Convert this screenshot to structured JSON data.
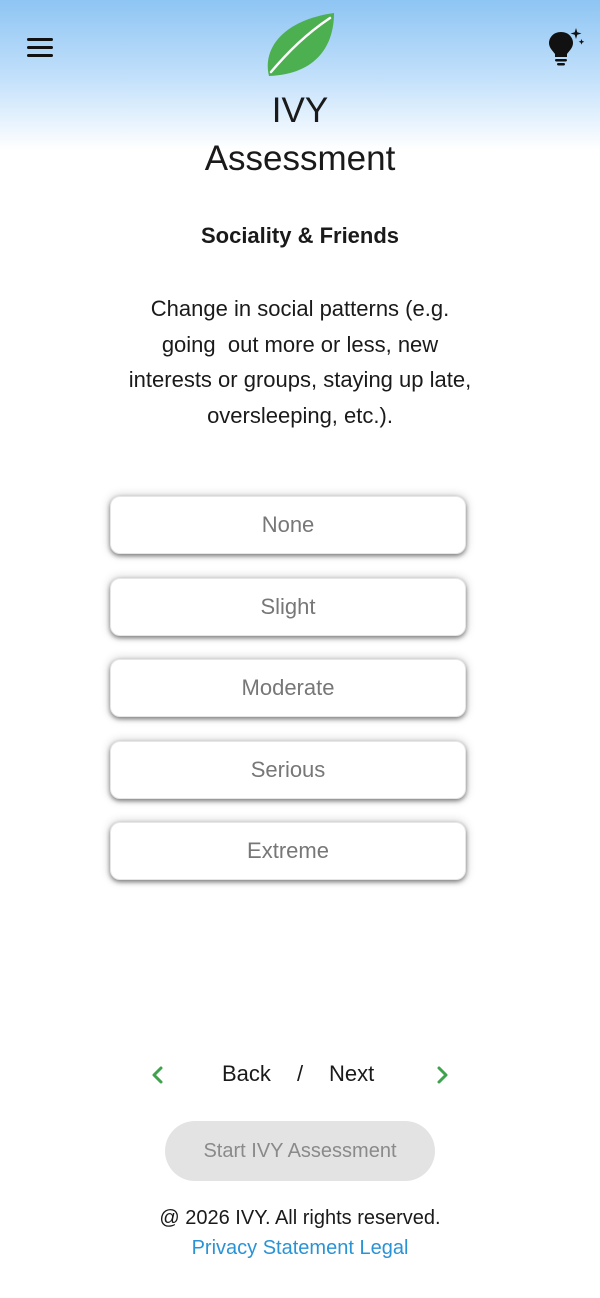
{
  "header": {
    "title_line1": "IVY",
    "title_line2": "Assessment"
  },
  "question": {
    "section": "Sociality & Friends",
    "text": "Change in social patterns (e.g.\ngoing  out more or less, new\ninterests or groups, staying up late,\noversleeping, etc.)."
  },
  "options": [
    {
      "label": "None"
    },
    {
      "label": "Slight"
    },
    {
      "label": "Moderate"
    },
    {
      "label": "Serious"
    },
    {
      "label": "Extreme"
    }
  ],
  "navigation": {
    "back_label": "Back",
    "separator": "/",
    "next_label": "Next"
  },
  "start_button": {
    "label": "Start IVY Assessment"
  },
  "footer": {
    "copyright": "@ 2026 IVY. All rights reserved.",
    "privacy_label": "Privacy Statement",
    "legal_label": "Legal"
  },
  "colors": {
    "accent_green": "#3fa34d",
    "link_blue": "#2a93d5",
    "header_gradient_top": "#8ec5f3"
  },
  "icons": {
    "menu": "hamburger-menu-icon",
    "logo": "leaf-icon",
    "tip": "lightbulb-sparkle-icon",
    "back": "chevron-left-icon",
    "next": "chevron-right-icon"
  }
}
